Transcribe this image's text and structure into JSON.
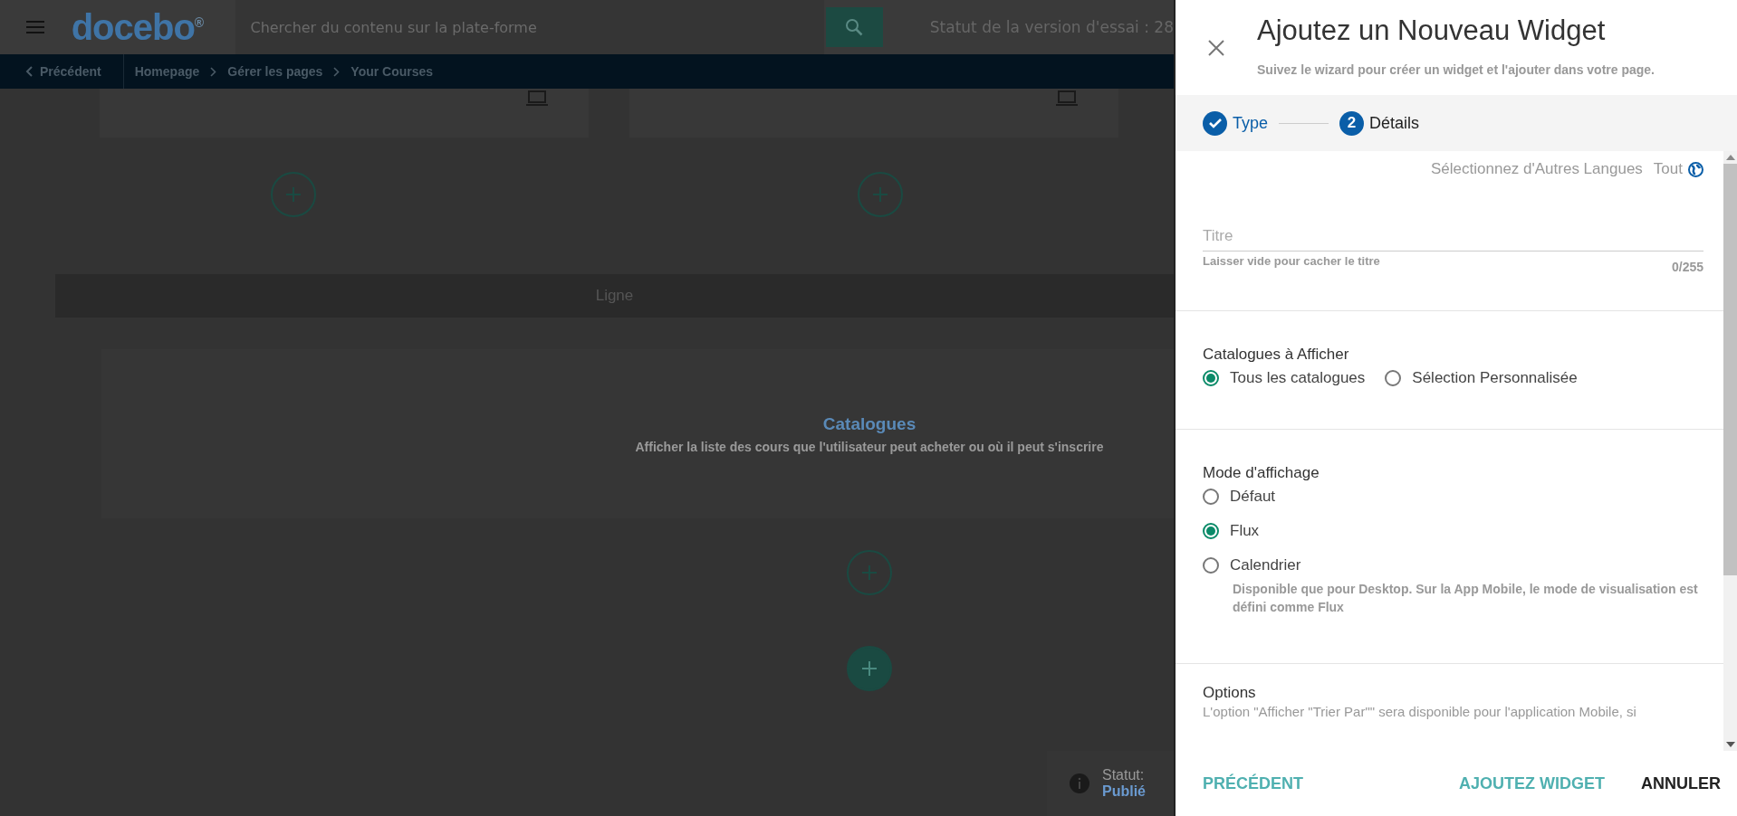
{
  "header": {
    "logo": "docebo",
    "logo_mark": "®",
    "search": {
      "placeholder": "Chercher du contenu sur la plate-forme"
    },
    "trial_status": "Statut de la version d'essai : 28"
  },
  "breadcrumb": {
    "back": "Précédent",
    "items": [
      "Homepage",
      "Gérer les pages",
      "Your Courses"
    ]
  },
  "canvas": {
    "divider_label": "Ligne",
    "widget": {
      "title": "Catalogues",
      "description": "Afficher la liste des cours que l'utilisateur peut acheter ou où il peut s'inscrire"
    },
    "status": {
      "label": "Statut:",
      "value": "Publié"
    }
  },
  "panel": {
    "title": "Ajoutez un Nouveau Widget",
    "subtitle": "Suivez le wizard pour créer un widget et l'ajouter dans votre page.",
    "steps": [
      {
        "kind": "done",
        "label": "Type"
      },
      {
        "kind": "current",
        "number": "2",
        "label": "Détails"
      }
    ],
    "languages": {
      "label": "Sélectionnez d'Autres Langues",
      "value": "Tout"
    },
    "title_field": {
      "placeholder": "Titre",
      "hint": "Laisser vide pour cacher le titre",
      "counter": "0/255"
    },
    "sections": [
      {
        "kind": "inline",
        "heading": "Catalogues à Afficher",
        "options": [
          {
            "label": "Tous les catalogues",
            "selected": true
          },
          {
            "label": "Sélection Personnalisée",
            "selected": false
          }
        ]
      },
      {
        "kind": "stacked",
        "heading": "Mode d'affichage",
        "options": [
          {
            "label": "Défaut",
            "selected": false
          },
          {
            "label": "Flux",
            "selected": true
          },
          {
            "label": "Calendrier",
            "selected": false,
            "note": "Disponible que pour Desktop. Sur la App Mobile, le mode de visualisation est défini comme Flux"
          }
        ]
      },
      {
        "kind": "text",
        "heading": "Options",
        "text": "L'option \"Afficher \"Trier Par\"\" sera disponible pour l'application Mobile, si"
      }
    ],
    "footer": {
      "back": "PRÉCÉDENT",
      "add": "AJOUTEZ WIDGET",
      "cancel": "ANNULER"
    }
  }
}
